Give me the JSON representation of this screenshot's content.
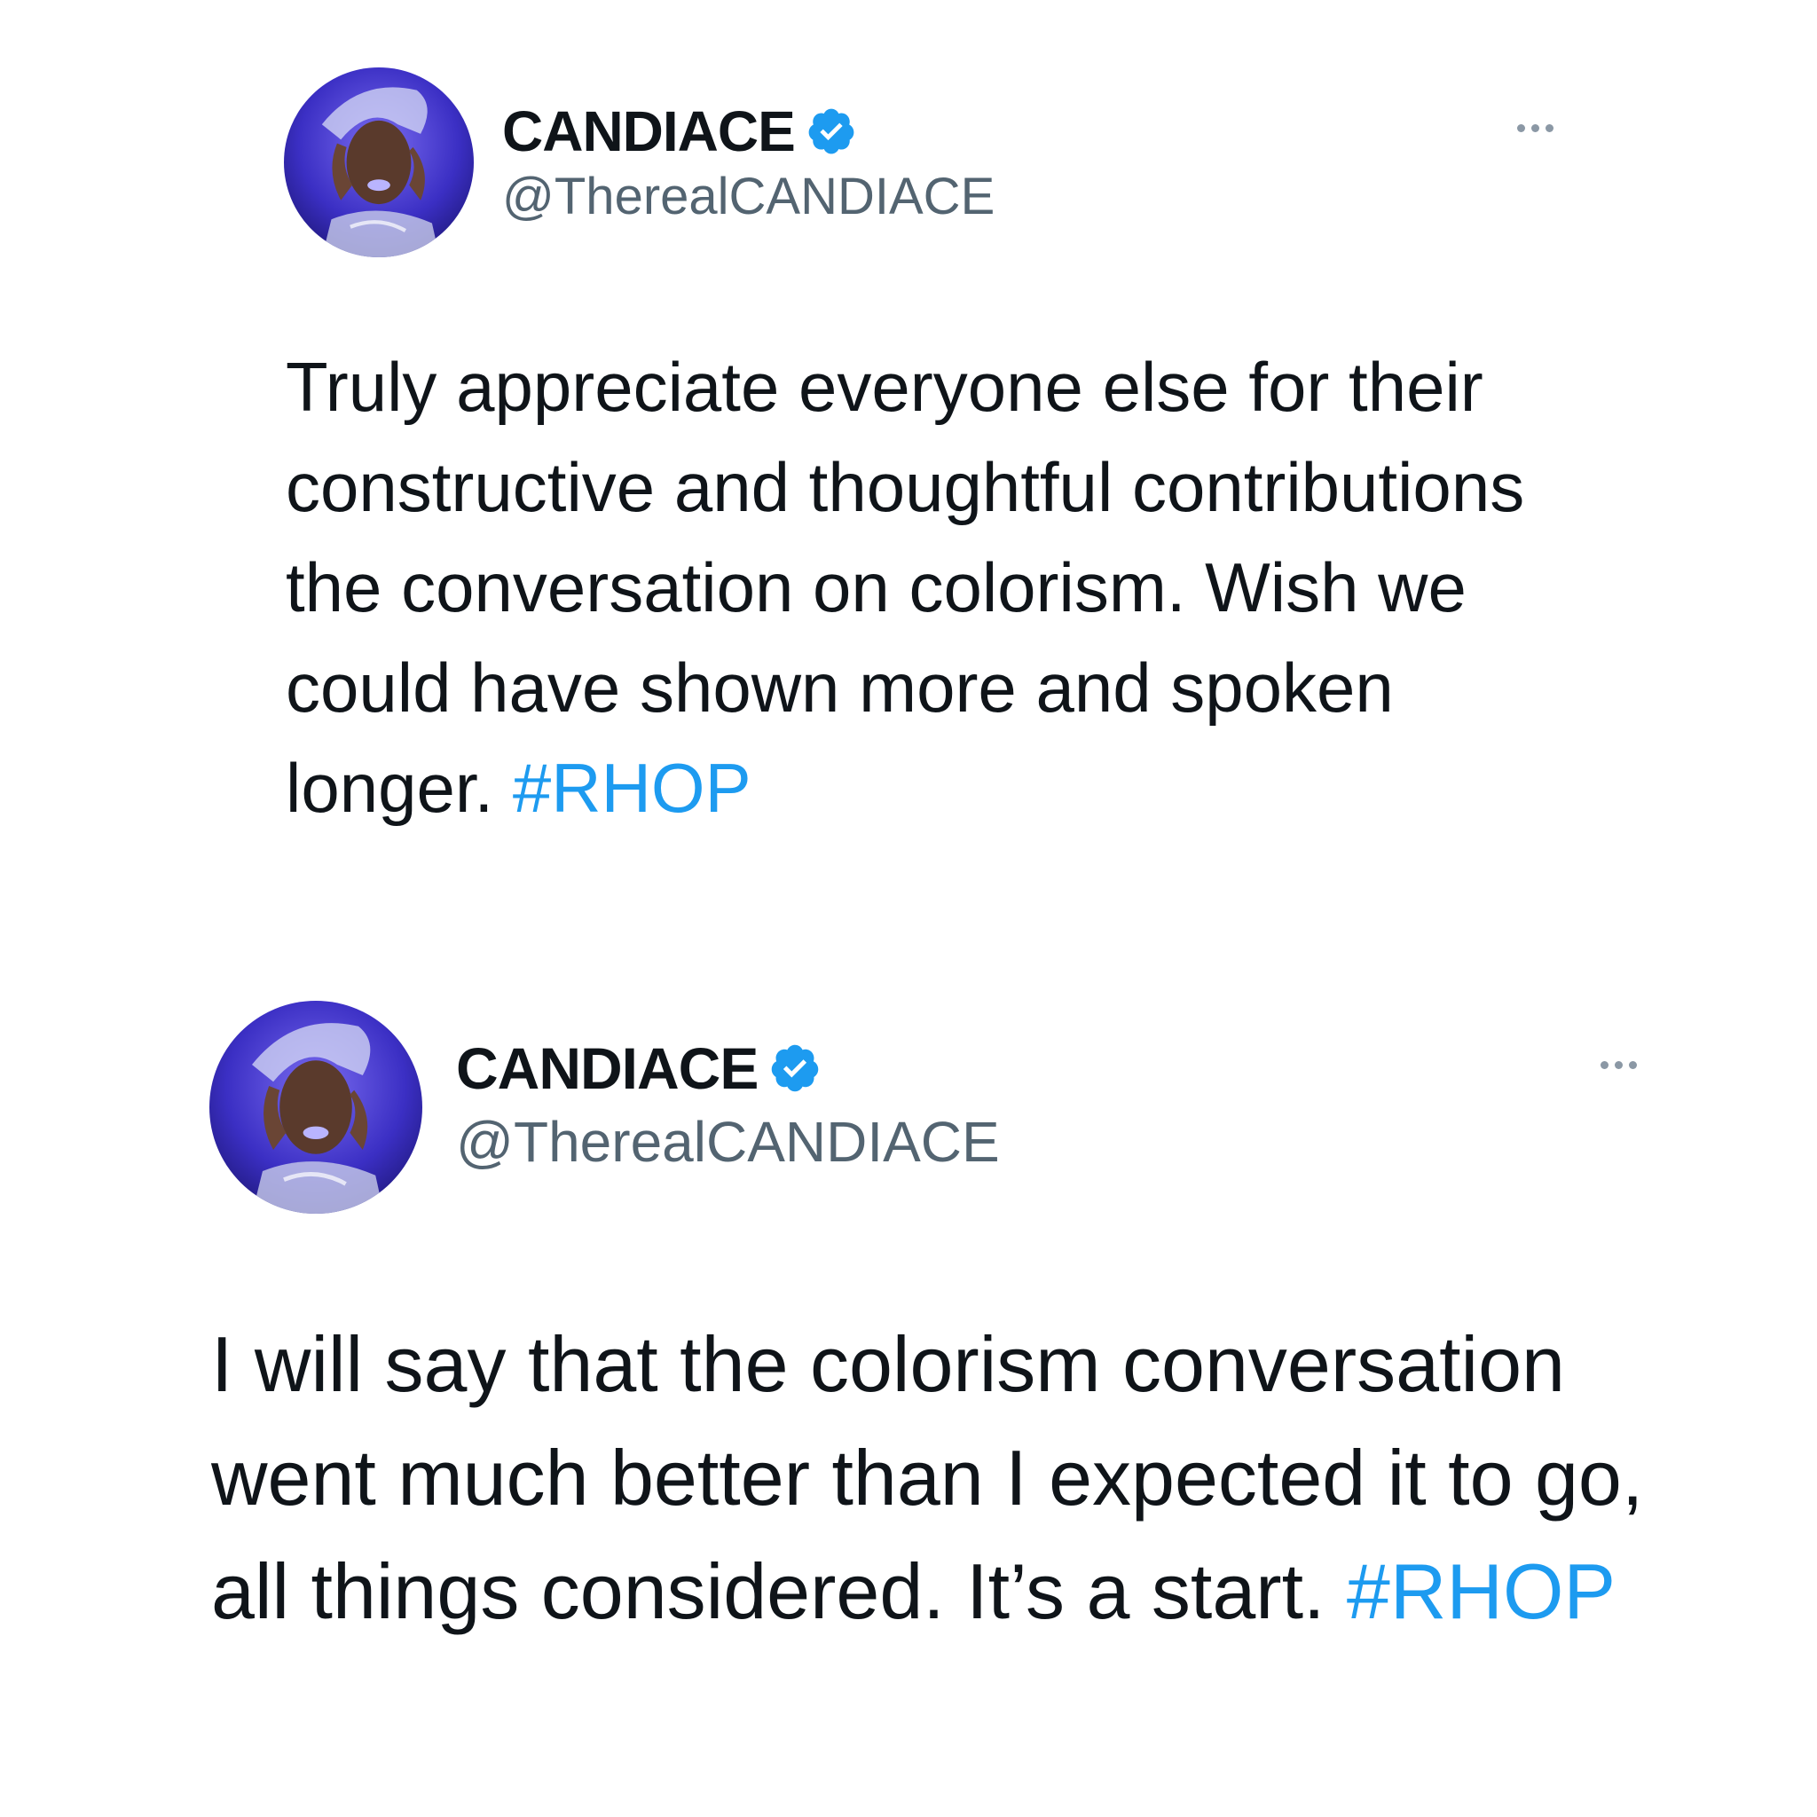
{
  "tweets": [
    {
      "display_name": "CANDIACE",
      "handle": "@TherealCANDIACE",
      "verified": true,
      "text": "Truly appreciate everyone else for their constructive and thoughtful contributions the conversation on colorism. Wish we could have shown more and spoken longer.",
      "hashtag": "#RHOP"
    },
    {
      "display_name": "CANDIACE",
      "handle": "@TherealCANDIACE",
      "verified": true,
      "text": "I will say that the colorism conversation went much better than I expected it to go, all things considered. It’s a start.",
      "hashtag": "#RHOP"
    }
  ],
  "icons": {
    "avatar": "profile-photo",
    "verified": "verified-badge-icon",
    "more": "more-options-icon"
  },
  "colors": {
    "text": "#0f1419",
    "handle": "#536471",
    "hashtag": "#1d9bf0",
    "verified": "#1d9bf0"
  }
}
